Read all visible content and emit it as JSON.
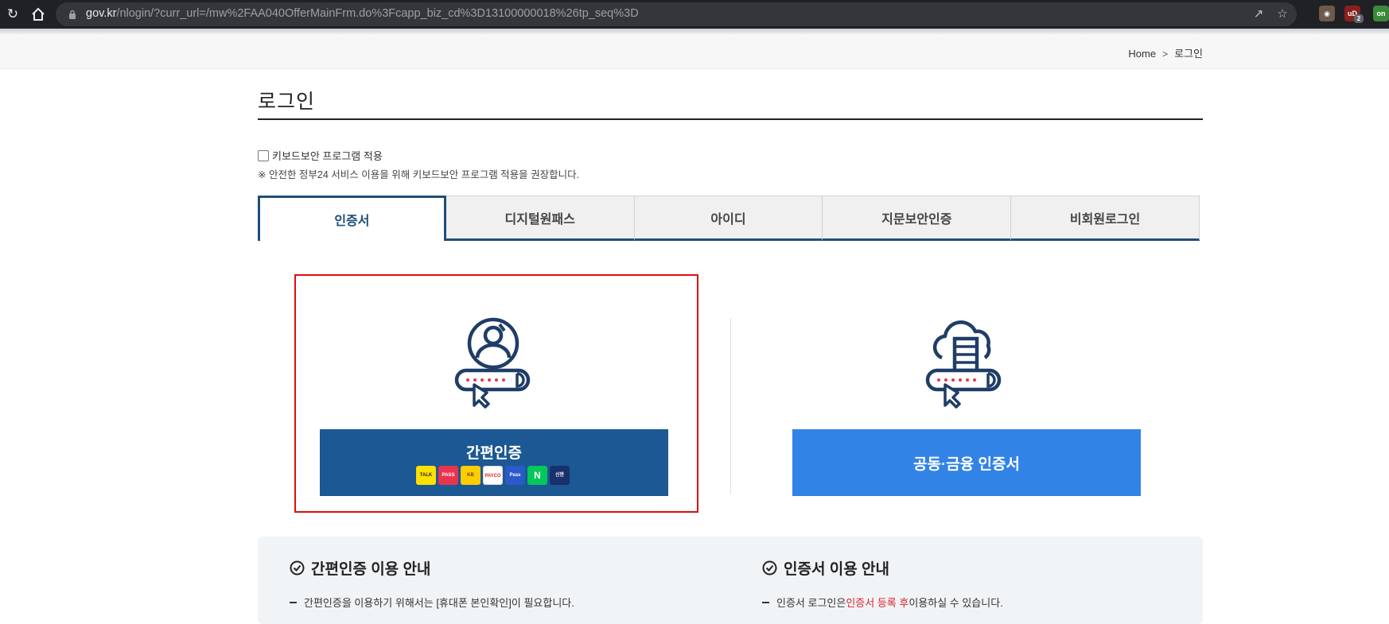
{
  "browser": {
    "url_domain": "gov.kr",
    "url_path": "/nlogin/?curr_url=/mw%2FAA040OfferMainFrm.do%3Fcapp_biz_cd%3D13100000018%26tp_seq%3D",
    "badge_count": "2"
  },
  "breadcrumb": {
    "home": "Home",
    "current": "로그인"
  },
  "page": {
    "title": "로그인"
  },
  "keyboard_security": {
    "label": "키보드보안 프로그램 적용",
    "note": "※ 안전한 정부24 서비스 이용을 위해 키보드보안 프로그램 적용을 권장합니다."
  },
  "tabs": [
    {
      "label": "인증서",
      "active": true
    },
    {
      "label": "디지털원패스",
      "active": false
    },
    {
      "label": "아이디",
      "active": false
    },
    {
      "label": "지문보안인증",
      "active": false
    },
    {
      "label": "비회원로그인",
      "active": false
    }
  ],
  "login_methods": {
    "simple_auth": {
      "label": "간편인증",
      "icon": "user-password-icon",
      "providers": [
        "TALK",
        "PASS",
        "KB",
        "PAYCO",
        "Pass",
        "N",
        "신한"
      ]
    },
    "certificate": {
      "label": "공동·금융 인증서",
      "icon": "cloud-server-password-icon"
    }
  },
  "info": {
    "simple_auth": {
      "title": "간편인증 이용 안내",
      "line": "간편인증을 이용하기 위해서는 [휴대폰 본인확인]이 필요합니다."
    },
    "certificate": {
      "title": "인증서 이용 안내",
      "line_prefix": "인증서 로그인은 ",
      "line_highlight": "인증서 등록 후",
      "line_suffix": " 이용하실 수 있습니다."
    }
  },
  "colors": {
    "primary_dark": "#1c5893",
    "primary_light": "#3283e6",
    "highlight_border": "#e30b0b",
    "tab_accent": "#1f4e79"
  }
}
